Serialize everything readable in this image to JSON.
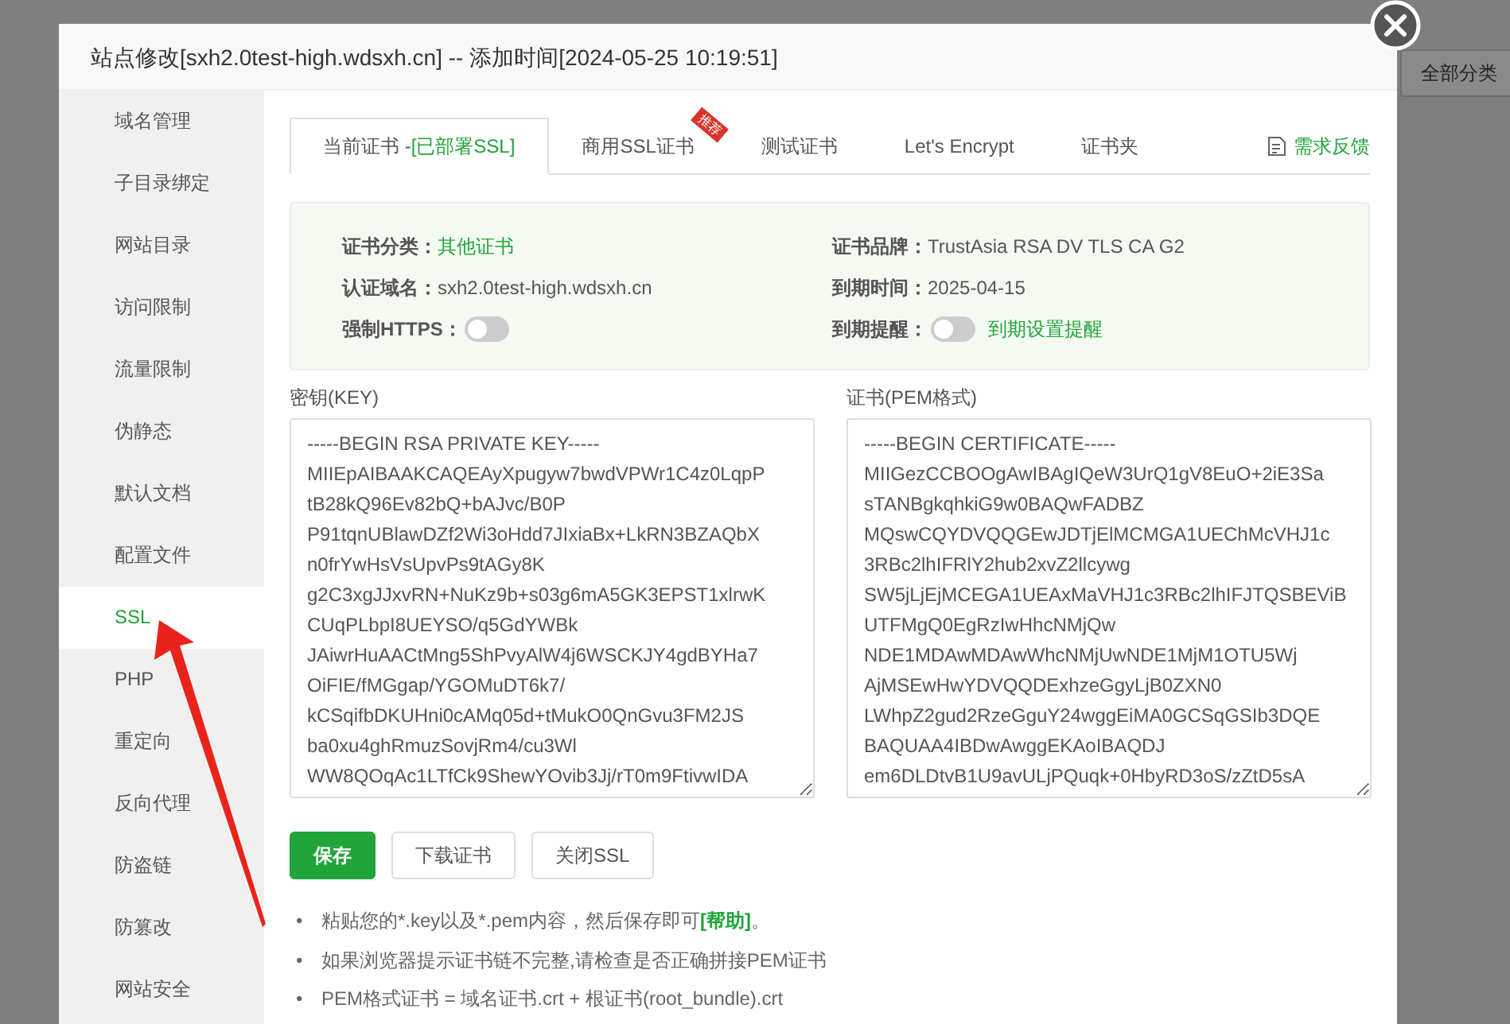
{
  "background": {
    "category_button": "全部分类"
  },
  "dialog": {
    "title": "站点修改[sxh2.0test-high.wdsxh.cn] -- 添加时间[2024-05-25 10:19:51]"
  },
  "sidebar": {
    "items": [
      {
        "label": "域名管理",
        "selected": false
      },
      {
        "label": "子目录绑定",
        "selected": false
      },
      {
        "label": "网站目录",
        "selected": false
      },
      {
        "label": "访问限制",
        "selected": false
      },
      {
        "label": "流量限制",
        "selected": false
      },
      {
        "label": "伪静态",
        "selected": false
      },
      {
        "label": "默认文档",
        "selected": false
      },
      {
        "label": "配置文件",
        "selected": false
      },
      {
        "label": "SSL",
        "selected": true
      },
      {
        "label": "PHP",
        "selected": false
      },
      {
        "label": "重定向",
        "selected": false
      },
      {
        "label": "反向代理",
        "selected": false
      },
      {
        "label": "防盗链",
        "selected": false
      },
      {
        "label": "防篡改",
        "selected": false
      },
      {
        "label": "网站安全",
        "selected": false
      }
    ]
  },
  "tabs": [
    {
      "label": "当前证书 -",
      "status": "[已部署SSL]",
      "selected": true
    },
    {
      "label": "商用SSL证书",
      "ribbon": "推荐",
      "selected": false
    },
    {
      "label": "测试证书",
      "selected": false
    },
    {
      "label": "Let's Encrypt",
      "selected": false
    },
    {
      "label": "证书夹",
      "selected": false
    }
  ],
  "feedback_link": "需求反馈",
  "cert_info": [
    {
      "label": "证书分类：",
      "kind": "highlight",
      "value": "其他证书"
    },
    {
      "label": "证书品牌：",
      "kind": "text",
      "value": "TrustAsia RSA DV TLS CA G2"
    },
    {
      "label": "认证域名：",
      "kind": "text",
      "value": "sxh2.0test-high.wdsxh.cn"
    },
    {
      "label": "到期时间：",
      "kind": "text",
      "value": "2025-04-15"
    },
    {
      "label": "强制HTTPS：",
      "kind": "toggle",
      "on": false
    },
    {
      "label": "到期提醒：",
      "kind": "toggle",
      "on": false,
      "link": "到期设置提醒"
    }
  ],
  "key": {
    "label": "密钥(KEY)",
    "lines": [
      "-----BEGIN RSA PRIVATE KEY-----",
      "MIIEpAIBAAKCAQEAyXpugyw7bwdVPWr1C4z0LqpP",
      "tB28kQ96Ev82bQ+bAJvc/B0P",
      "P91tqnUBlawDZf2Wi3oHdd7JIxiaBx+LkRN3BZAQbX",
      "n0frYwHsVsUpvPs9tAGy8K",
      "g2C3xgJJxvRN+NuKz9b+s03g6mA5GK3EPST1xlrwK",
      "CUqPLbpI8UEYSO/q5GdYWBk",
      "JAiwrHuAACtMng5ShPvyAlW4j6WSCKJY4gdBYHa7",
      "OiFIE/fMGgap/YGOMuDT6k7/",
      "kCSqifbDKUHni0cAMq05d+tMukO0QnGvu3FM2JS",
      "ba0xu4ghRmuzSovjRm4/cu3Wl",
      "WW8QOqAc1LTfCk9ShewYOvib3Jj/rT0m9FtivwIDA"
    ]
  },
  "certificate": {
    "label": "证书(PEM格式)",
    "lines": [
      "-----BEGIN CERTIFICATE-----",
      "MIIGezCCBOOgAwIBAgIQeW3UrQ1gV8EuO+2iE3Sa",
      "sTANBgkqhkiG9w0BAQwFADBZ",
      "MQswCQYDVQQGEwJDTjElMCMGA1UEChMcVHJ1c",
      "3RBc2lhIFRlY2hub2xvZ2llcywg",
      "SW5jLjEjMCEGA1UEAxMaVHJ1c3RBc2lhIFJTQSBEViB",
      "UTFMgQ0EgRzIwHhcNMjQw",
      "NDE1MDAwMDAwWhcNMjUwNDE1MjM1OTU5Wj",
      "AjMSEwHwYDVQQDExhzeGgyLjB0ZXN0",
      "LWhpZ2gud2RzeGguY24wggEiMA0GCSqGSIb3DQE",
      "BAQUAA4IBDwAwggEKAoIBAQDJ",
      "em6DLDtvB1U9avULjPQuqk+0HbyRD3oS/zZtD5sA"
    ]
  },
  "buttons": [
    {
      "label": "保存",
      "kind": "primary"
    },
    {
      "label": "下载证书",
      "kind": "default"
    },
    {
      "label": "关闭SSL",
      "kind": "default"
    }
  ],
  "notes": [
    {
      "bullet": "•",
      "text": "粘贴您的*.key以及*.pem内容，然后保存即可",
      "link": "[帮助]",
      "suffix": "。"
    },
    {
      "bullet": "•",
      "text": "如果浏览器提示证书链不完整,请检查是否正确拼接PEM证书"
    },
    {
      "bullet": "•",
      "text": "PEM格式证书 = 域名证书.crt + 根证书(root_bundle).crt"
    }
  ]
}
